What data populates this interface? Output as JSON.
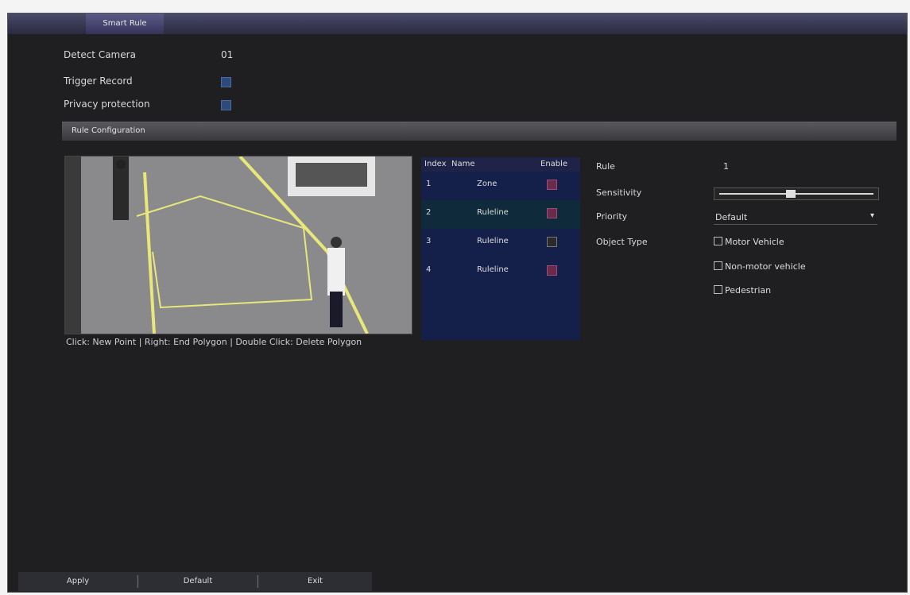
{
  "header": {
    "tab_label": "Smart Rule"
  },
  "settings": {
    "detect_camera_label": "Detect Camera",
    "detect_camera_value": "01",
    "trigger_record_label": "Trigger Record",
    "privacy_label": "Privacy protection"
  },
  "section": {
    "title": "Rule Configuration"
  },
  "video": {
    "caption": "Click: New Point | Right: End Polygon | Double Click: Delete Polygon"
  },
  "table": {
    "headers": [
      "Index",
      "Name",
      "Enable"
    ],
    "rows": [
      {
        "index": "1",
        "value": "Zone"
      },
      {
        "index": "2",
        "value": "Ruleline"
      },
      {
        "index": "3",
        "value": "Ruleline"
      },
      {
        "index": "4",
        "value": "Ruleline"
      }
    ]
  },
  "rule": {
    "rule_label": "Rule",
    "rule_value": "1",
    "sensitivity_label": "Sensitivity",
    "priority_label": "Priority",
    "priority_value": "Default",
    "object_type_label": "Object Type",
    "checkboxes": [
      "Motor Vehicle",
      "Non-motor vehicle",
      "Pedestrian"
    ]
  },
  "footer": {
    "buttons": [
      "Apply",
      "Default",
      "Exit"
    ]
  }
}
